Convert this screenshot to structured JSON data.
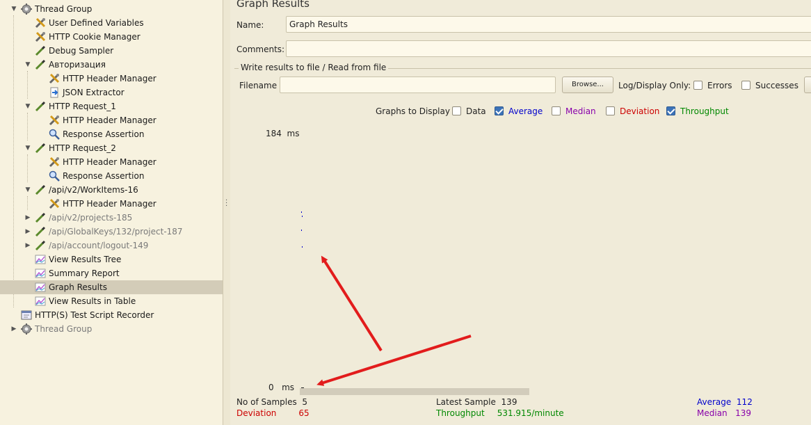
{
  "tree": {
    "items": [
      {
        "label": "Thread Group",
        "icon": "gear-icon",
        "level": 0,
        "expanded": true,
        "disabled": false,
        "selected": false
      },
      {
        "label": "User Defined Variables",
        "icon": "wrench-screwdriver-icon",
        "level": 1,
        "disabled": false,
        "selected": false
      },
      {
        "label": "HTTP Cookie Manager",
        "icon": "wrench-screwdriver-icon",
        "level": 1,
        "disabled": false,
        "selected": false
      },
      {
        "label": "Debug Sampler",
        "icon": "pipette-icon",
        "level": 1,
        "disabled": false,
        "selected": false
      },
      {
        "label": "Авторизация",
        "icon": "pipette-icon",
        "level": 1,
        "expanded": true,
        "disabled": false,
        "selected": false
      },
      {
        "label": "HTTP Header Manager",
        "icon": "wrench-screwdriver-icon",
        "level": 2,
        "disabled": false,
        "selected": false
      },
      {
        "label": "JSON Extractor",
        "icon": "document-arrow-icon",
        "level": 2,
        "disabled": false,
        "selected": false
      },
      {
        "label": "HTTP Request_1",
        "icon": "pipette-icon",
        "level": 1,
        "expanded": true,
        "disabled": false,
        "selected": false
      },
      {
        "label": "HTTP Header Manager",
        "icon": "wrench-screwdriver-icon",
        "level": 2,
        "disabled": false,
        "selected": false
      },
      {
        "label": "Response Assertion",
        "icon": "magnifier-icon",
        "level": 2,
        "disabled": false,
        "selected": false
      },
      {
        "label": "HTTP Request_2",
        "icon": "pipette-icon",
        "level": 1,
        "expanded": true,
        "disabled": false,
        "selected": false
      },
      {
        "label": "HTTP Header Manager",
        "icon": "wrench-screwdriver-icon",
        "level": 2,
        "disabled": false,
        "selected": false
      },
      {
        "label": "Response Assertion",
        "icon": "magnifier-icon",
        "level": 2,
        "disabled": false,
        "selected": false
      },
      {
        "label": "/api/v2/WorkItems-16",
        "icon": "pipette-icon",
        "level": 1,
        "expanded": true,
        "disabled": false,
        "selected": false
      },
      {
        "label": "HTTP Header Manager",
        "icon": "wrench-screwdriver-icon",
        "level": 2,
        "disabled": false,
        "selected": false
      },
      {
        "label": "/api/v2/projects-185",
        "icon": "pipette-icon",
        "level": 1,
        "expanded": false,
        "disabled": true,
        "selected": false
      },
      {
        "label": "/api/GlobalKeys/132/project-187",
        "icon": "pipette-icon",
        "level": 1,
        "expanded": false,
        "disabled": true,
        "selected": false
      },
      {
        "label": "/api/account/logout-149",
        "icon": "pipette-icon",
        "level": 1,
        "expanded": false,
        "disabled": true,
        "selected": false
      },
      {
        "label": "View Results Tree",
        "icon": "graph-icon",
        "level": 1,
        "disabled": false,
        "selected": false
      },
      {
        "label": "Summary Report",
        "icon": "graph-icon",
        "level": 1,
        "disabled": false,
        "selected": false
      },
      {
        "label": "Graph Results",
        "icon": "graph-icon",
        "level": 1,
        "disabled": false,
        "selected": true
      },
      {
        "label": "View Results in Table",
        "icon": "graph-icon",
        "level": 1,
        "disabled": false,
        "selected": false
      },
      {
        "label": "HTTP(S) Test Script Recorder",
        "icon": "recorder-icon",
        "level": 0,
        "disabled": false,
        "selected": false
      },
      {
        "label": "Thread Group",
        "icon": "gear-icon",
        "level": 0,
        "expanded": false,
        "disabled": true,
        "selected": false
      }
    ]
  },
  "panel": {
    "title": "Graph Results",
    "name_label": "Name:",
    "name_value": "Graph Results",
    "comments_label": "Comments:",
    "comments_value": "",
    "file_group_title": "Write results to file / Read from file",
    "filename_label": "Filename",
    "filename_value": "",
    "browse_label": "Browse...",
    "log_display_label": "Log/Display Only:",
    "errors_label": "Errors",
    "errors_checked": false,
    "successes_label": "Successes",
    "successes_checked": false
  },
  "graphs": {
    "label": "Graphs to Display",
    "options": [
      {
        "label": "Data",
        "checked": false,
        "color": "#222222"
      },
      {
        "label": "Average",
        "checked": true,
        "color": "#0000cc"
      },
      {
        "label": "Median",
        "checked": false,
        "color": "#8800aa"
      },
      {
        "label": "Deviation",
        "checked": false,
        "color": "#cc0000"
      },
      {
        "label": "Throughput",
        "checked": true,
        "color": "#008800"
      }
    ]
  },
  "chart_data": {
    "type": "scatter",
    "title": "",
    "ylabel": "",
    "y_top_label": "184",
    "y_bottom_label": "0",
    "y_unit": "ms",
    "ylim": [
      0,
      184
    ],
    "series": [
      {
        "values": [
          127,
          124,
          114,
          102,
          0
        ]
      }
    ]
  },
  "stats": {
    "samples_label": "No of Samples",
    "samples_value": "5",
    "latest_label": "Latest Sample",
    "latest_value": "139",
    "average_label": "Average",
    "average_value": "112",
    "deviation_label": "Deviation",
    "deviation_value": "65",
    "throughput_label": "Throughput",
    "throughput_value": "531.915/minute",
    "median_label": "Median",
    "median_value": "139",
    "colors": {
      "average": "#0000cc",
      "deviation": "#cc0000",
      "throughput": "#008800",
      "median": "#8800aa"
    }
  }
}
